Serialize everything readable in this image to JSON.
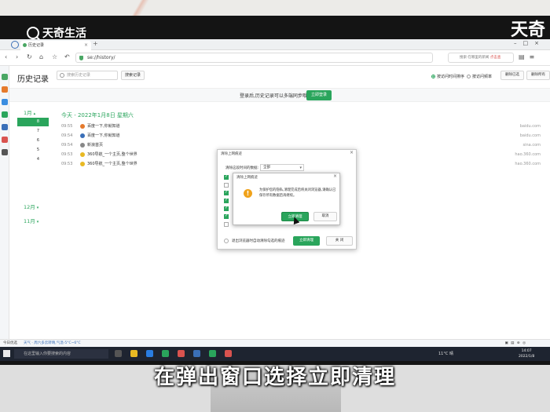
{
  "watermark": {
    "brand_left": "天奇生活",
    "brand_right": "天奇"
  },
  "caption": "在弹出窗口选择立即清理",
  "browser": {
    "tab_title": "历史记录",
    "url": "se://history/",
    "search_placeholder": "搜索·在哪里的新闻",
    "search_tag": "点击查"
  },
  "page": {
    "title": "历史记录",
    "search_placeholder": "搜索历史记录",
    "search_button": "搜索记录",
    "radio_on": "按访问时间排序",
    "radio_off": "按访问频率",
    "btn_delete_selected": "删除已选",
    "btn_clear_all": "删除所有"
  },
  "banner": {
    "text": "登录后,历史记录可以多端同步哦~",
    "button": "立即登录"
  },
  "calendar": {
    "months": [
      "1月",
      "12月",
      "11月"
    ],
    "days": [
      "8",
      "7",
      "6",
      "5",
      "4"
    ],
    "active_day": "8"
  },
  "history": {
    "header": "今天 - 2022年1月8日 星期六",
    "rows": [
      {
        "time": "09:55",
        "title": "百度一下,你就知道",
        "domain": "baidu.com"
      },
      {
        "time": "09:54",
        "title": "百度一下,你就知道",
        "domain": "baidu.com"
      },
      {
        "time": "09:54",
        "title": "新浪首页",
        "domain": "sina.com"
      },
      {
        "time": "09:53",
        "title": "360导航_一个主页,整个世界",
        "domain": "hao.360.com"
      },
      {
        "time": "09:53",
        "title": "360导航_一个主页,整个世界",
        "domain": "hao.360.com"
      }
    ]
  },
  "clear_dialog": {
    "title": "清除上网痕迹",
    "range_label": "清除这段时间的数据:",
    "range_value": "全部",
    "bottom_option": "退出浏览器时自动清除勾选的痕迹",
    "clean_button": "立即清理",
    "close_button": "关 闭"
  },
  "confirm_dialog": {
    "title": "清除上网痕迹",
    "message": "为保护您的隐私,清理完成后将关闭浏览器,请确认已保存所有数据后再继续。",
    "ok": "立即清理",
    "cancel": "取消"
  },
  "statusbar": {
    "left": "今日优选",
    "news": "天气 · 周六多云转晴,气温-5°C~6°C"
  },
  "taskbar": {
    "search_placeholder": "在这里输入你要搜索的内容",
    "weather": "11°C 晴",
    "time": "14:07",
    "date": "2022/1/8"
  },
  "colors": {
    "accent": "#2aa55c",
    "warning": "#f0a21b"
  }
}
